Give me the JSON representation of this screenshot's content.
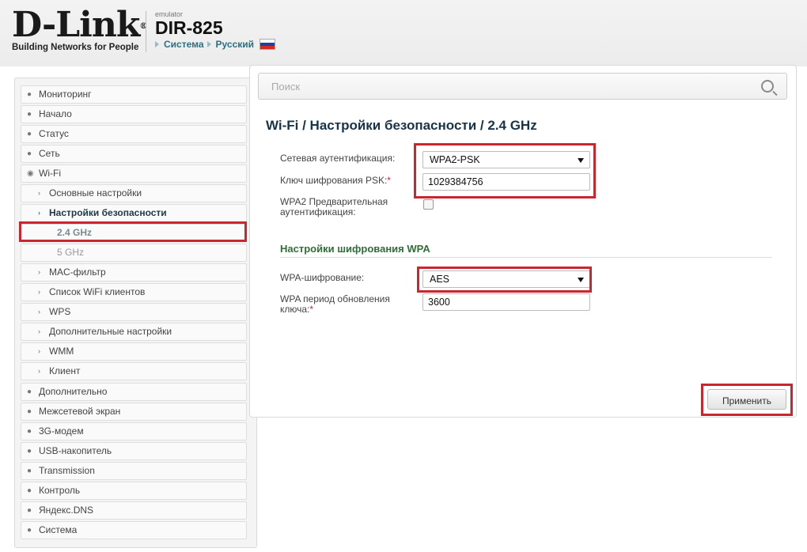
{
  "header": {
    "logo_text": "D-Link",
    "logo_reg": "®",
    "tagline": "Building Networks for People",
    "emulator_label": "emulator",
    "model": "DIR-825",
    "link_system": "Система",
    "link_language": "Русский",
    "flag_icon": "russia-flag-icon"
  },
  "sidebar": {
    "items": [
      {
        "label": "Мониторинг",
        "icon": "circle-arrow-icon"
      },
      {
        "label": "Начало",
        "icon": "circle-arrow-icon"
      },
      {
        "label": "Статус",
        "icon": "circle-arrow-icon"
      },
      {
        "label": "Сеть",
        "icon": "circle-arrow-icon"
      },
      {
        "label": "Wi-Fi",
        "icon": "circle-chevron-down-icon"
      },
      {
        "label": "Основные настройки",
        "icon": "chevron-right-icon"
      },
      {
        "label": "Настройки безопасности",
        "icon": "chevron-right-icon"
      },
      {
        "label": "2.4 GHz"
      },
      {
        "label": "5 GHz"
      },
      {
        "label": "MAC-фильтр",
        "icon": "chevron-right-icon"
      },
      {
        "label": "Список WiFi клиентов",
        "icon": "chevron-right-icon"
      },
      {
        "label": "WPS",
        "icon": "chevron-right-icon"
      },
      {
        "label": "Дополнительные настройки",
        "icon": "chevron-right-icon"
      },
      {
        "label": "WMM",
        "icon": "chevron-right-icon"
      },
      {
        "label": "Клиент",
        "icon": "chevron-right-icon"
      },
      {
        "label": "Дополнительно",
        "icon": "circle-arrow-icon"
      },
      {
        "label": "Межсетевой экран",
        "icon": "circle-arrow-icon"
      },
      {
        "label": "3G-модем",
        "icon": "circle-arrow-icon"
      },
      {
        "label": "USB-накопитель",
        "icon": "circle-arrow-icon"
      },
      {
        "label": "Transmission",
        "icon": "circle-arrow-icon"
      },
      {
        "label": "Контроль",
        "icon": "circle-arrow-icon"
      },
      {
        "label": "Яндекс.DNS",
        "icon": "circle-arrow-icon"
      },
      {
        "label": "Система",
        "icon": "circle-arrow-icon"
      }
    ]
  },
  "search": {
    "placeholder": "Поиск",
    "icon": "search-icon"
  },
  "main": {
    "breadcrumb": "Wi-Fi /  Настройки безопасности /  2.4 GHz",
    "auth_label": "Сетевая аутентификация:",
    "auth_value": "WPA2-PSK",
    "psk_label": "Ключ шифрования PSK:",
    "psk_value": "1029384756",
    "preauth_label_1": "WPA2 Предварительная",
    "preauth_label_2": "аутентификация:",
    "section_title": "Настройки шифрования WPA",
    "wpa_enc_label": "WPA-шифрование:",
    "wpa_enc_value": "AES",
    "rekey_label_1": "WPA период обновления",
    "rekey_label_2": "ключа:",
    "rekey_value": "3600",
    "required_mark": "*"
  },
  "actions": {
    "apply_label": "Применить"
  },
  "colors": {
    "highlight": "#c9262f",
    "accent": "#2f7d96",
    "section_green": "#2e6f37"
  }
}
